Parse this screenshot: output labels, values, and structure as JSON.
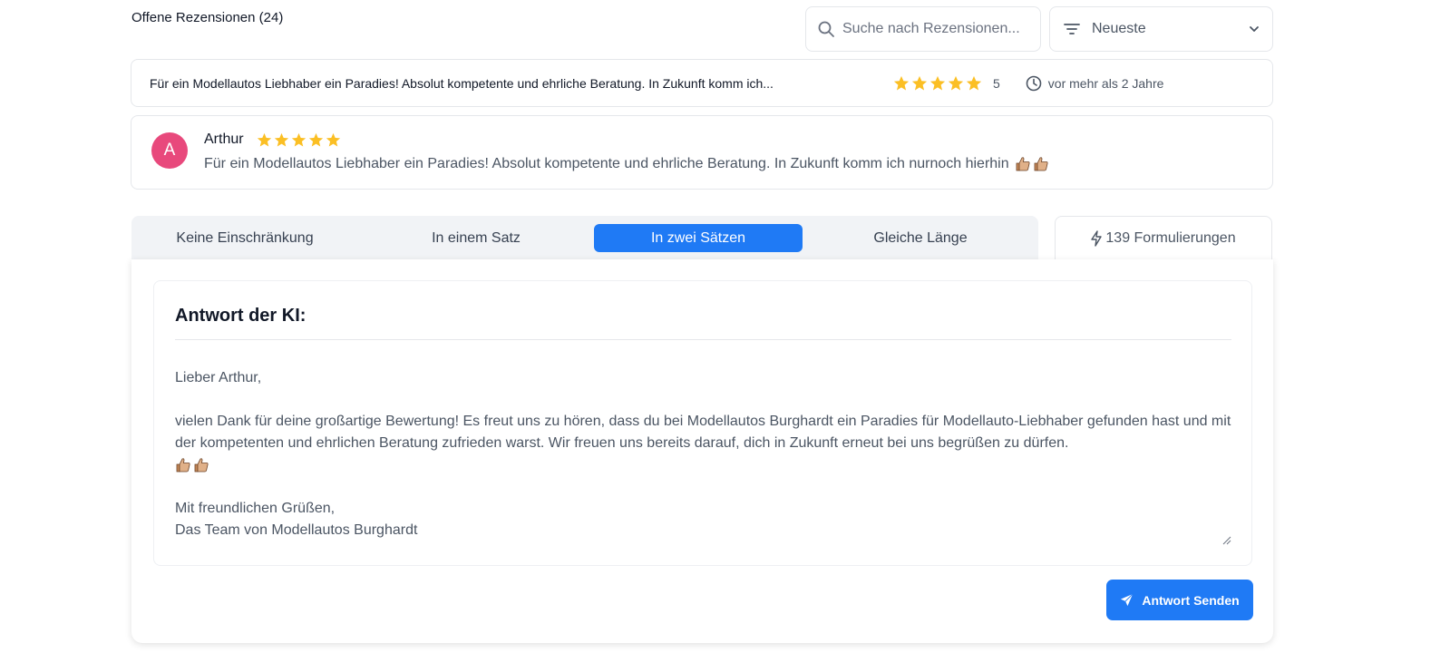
{
  "header": {
    "title": "Offene Rezensionen (24)",
    "search_placeholder": "Suche nach Rezensionen...",
    "sort_value": "Neueste"
  },
  "review_list": [
    {
      "preview_text": "Für ein Modellautos Liebhaber ein Paradies! Absolut kompetente und ehrliche Beratung. In Zukunft komm ich...",
      "stars": 5,
      "rating_label": "5",
      "time_ago": "vor mehr als 2 Jahre"
    }
  ],
  "selected_review": {
    "avatar_initial": "A",
    "avatar_color": "#e8497c",
    "name": "Arthur",
    "stars": 5,
    "text": "Für ein Modellautos Liebhaber ein Paradies! Absolut kompetente und ehrliche Beratung. In Zukunft komm ich nurnoch hierhin",
    "emoji_icons": [
      "thumbs-up-icon",
      "thumbs-up-icon"
    ]
  },
  "tabs": [
    {
      "label": "Keine Einschränkung",
      "active": false
    },
    {
      "label": "In einem Satz",
      "active": false
    },
    {
      "label": "In zwei Sätzen",
      "active": true
    },
    {
      "label": "Gleiche Länge",
      "active": false
    }
  ],
  "formulations_label": "139 Formulierungen",
  "ai_response": {
    "heading": "Antwort der KI:",
    "greeting": "Lieber Arthur,",
    "body": "vielen Dank für deine großartige Bewertung! Es freut uns zu hören, dass du bei Modellautos Burghardt ein Paradies für Modellauto-Liebhaber gefunden hast und mit der kompetenten und ehrlichen Beratung zufrieden warst. Wir freuen uns bereits darauf, dich in Zukunft erneut bei uns begrüßen zu dürfen.",
    "closing": "Mit freundlichen Grüßen,",
    "signature": "Das Team von Modellautos Burghardt"
  },
  "send_button_label": "Antwort Senden",
  "colors": {
    "accent": "#1f7af5",
    "star": "#fbbf24",
    "avatar": "#e8497c"
  }
}
